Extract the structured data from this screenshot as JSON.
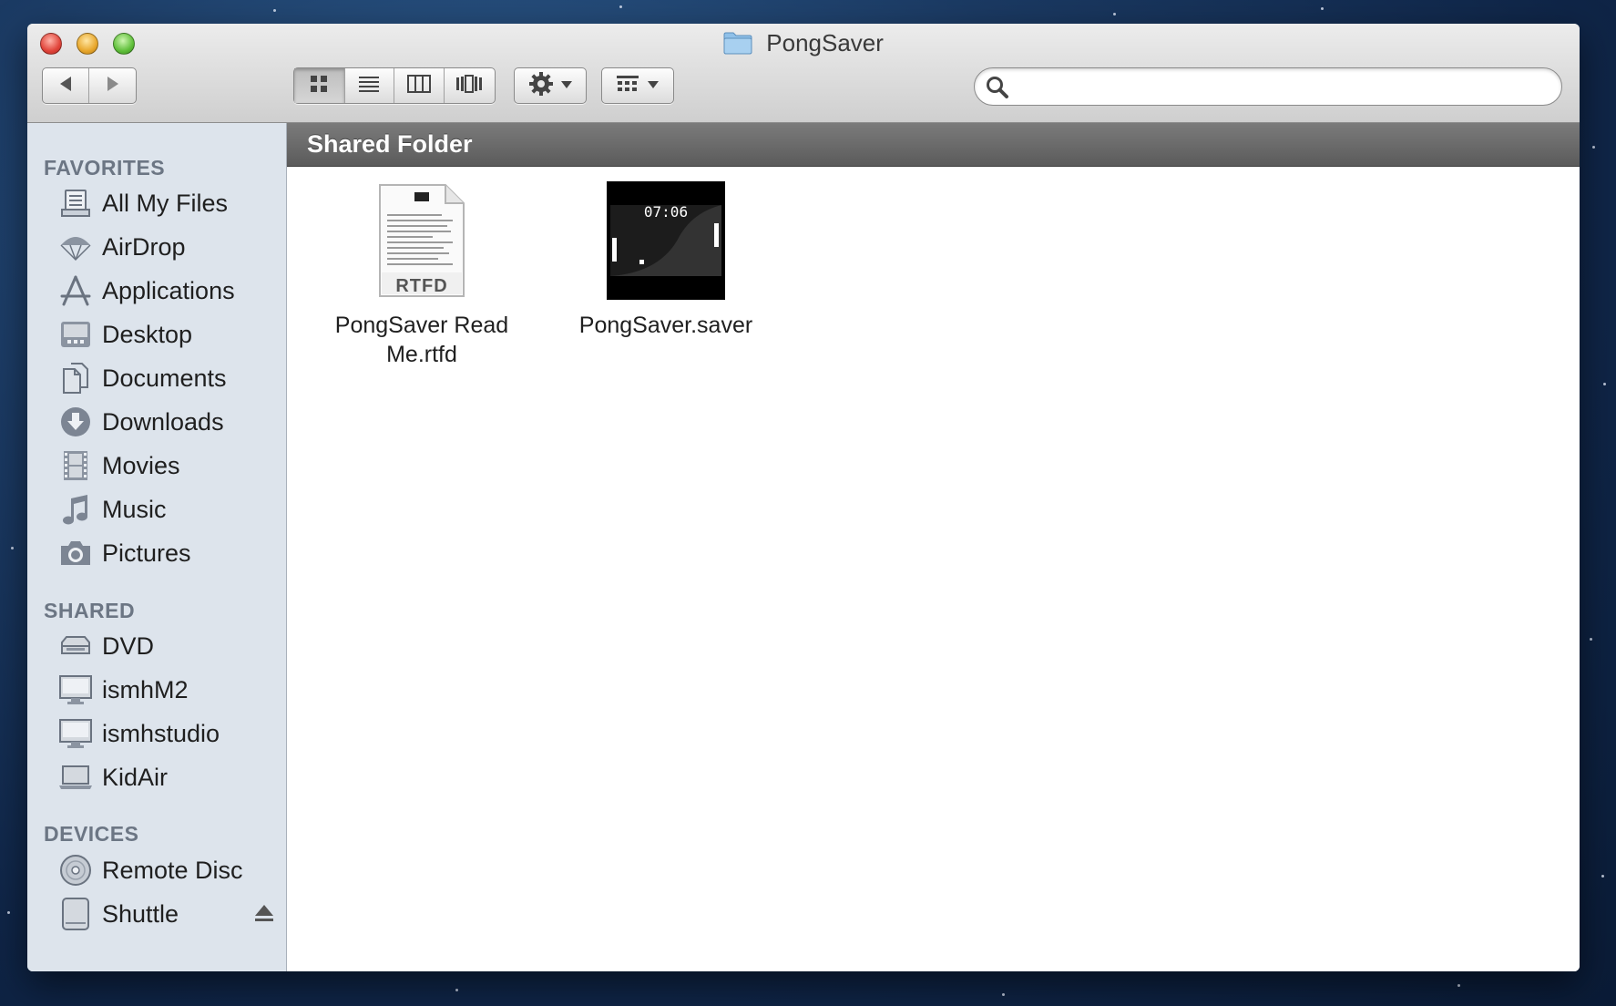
{
  "window": {
    "title": "PongSaver"
  },
  "toolbar": {
    "back_icon": "chevron-left-icon",
    "forward_icon": "chevron-right-icon",
    "view_modes": [
      "icon-view",
      "list-view",
      "column-view",
      "cover-flow-view"
    ],
    "active_view": "icon-view",
    "action_icon": "gear-icon",
    "arrange_icon": "grid-icon"
  },
  "search": {
    "value": "",
    "placeholder": ""
  },
  "sidebar": {
    "favorites_header": "FAVORITES",
    "favorites": [
      {
        "label": "All My Files",
        "icon": "all-files-icon"
      },
      {
        "label": "AirDrop",
        "icon": "airdrop-icon"
      },
      {
        "label": "Applications",
        "icon": "applications-icon"
      },
      {
        "label": "Desktop",
        "icon": "desktop-icon"
      },
      {
        "label": "Documents",
        "icon": "documents-icon"
      },
      {
        "label": "Downloads",
        "icon": "downloads-icon"
      },
      {
        "label": "Movies",
        "icon": "movies-icon"
      },
      {
        "label": "Music",
        "icon": "music-icon"
      },
      {
        "label": "Pictures",
        "icon": "pictures-icon"
      }
    ],
    "shared_header": "SHARED",
    "shared": [
      {
        "label": "DVD",
        "icon": "dvd-icon"
      },
      {
        "label": "ismhM2",
        "icon": "computer-icon"
      },
      {
        "label": "ismhstudio",
        "icon": "computer-icon"
      },
      {
        "label": "KidAir",
        "icon": "laptop-icon"
      }
    ],
    "devices_header": "DEVICES",
    "devices": [
      {
        "label": "Remote Disc",
        "icon": "disc-icon"
      },
      {
        "label": "Shuttle",
        "icon": "drive-icon"
      }
    ]
  },
  "content": {
    "path_title": "Shared Folder",
    "files": [
      {
        "name": "PongSaver Read Me.rtfd",
        "badge": "RTFD",
        "icon": "rtfd-document-icon"
      },
      {
        "name": "PongSaver.saver",
        "time": "07:06",
        "icon": "screensaver-icon"
      }
    ]
  },
  "colors": {
    "sidebar_bg": "#dde4ec",
    "section_header": "#6c7684",
    "path_bar": "#6b6b6b"
  }
}
